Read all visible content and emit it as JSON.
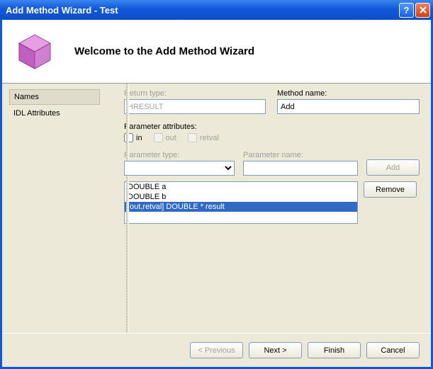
{
  "window": {
    "title": "Add Method Wizard - Test"
  },
  "header": {
    "welcome": "Welcome to the Add Method Wizard"
  },
  "sidebar": {
    "items": [
      {
        "label": "Names",
        "selected": true
      },
      {
        "label": "IDL Attributes",
        "selected": false
      }
    ]
  },
  "form": {
    "return_type_label": "Return type:",
    "return_type_value": "HRESULT",
    "method_name_label": "Method name:",
    "method_name_value": "Add",
    "param_attr_label": "Parameter attributes:",
    "checkboxes": {
      "in": "in",
      "out": "out",
      "retval": "retval"
    },
    "param_type_label": "Parameter type:",
    "param_type_value": "",
    "param_name_label": "Parameter name:",
    "param_name_value": "",
    "add_btn": "Add",
    "remove_btn": "Remove",
    "param_list": [
      "DOUBLE a",
      "DOUBLE b",
      "[out,retval] DOUBLE * result"
    ],
    "selected_param_index": 2
  },
  "footer": {
    "prev": "< Previous",
    "next": "Next >",
    "finish": "Finish",
    "cancel": "Cancel"
  }
}
